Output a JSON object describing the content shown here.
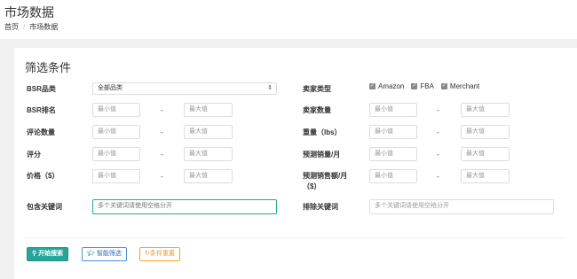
{
  "header": {
    "title": "市场数据",
    "breadcrumb_home": "首页",
    "breadcrumb_sep": "/",
    "breadcrumb_current": "市场数据"
  },
  "panel": {
    "title": "筛选条件"
  },
  "icons": {
    "search": "search-icon",
    "filter": "mortarboard-icon",
    "reset": "refresh-icon"
  },
  "filters": {
    "bsr_category": {
      "label": "BSR品类",
      "value": "全部品类"
    },
    "bsr_rank": {
      "label": "BSR排名"
    },
    "reviews": {
      "label": "评论数量"
    },
    "rating": {
      "label": "评分"
    },
    "price": {
      "label": "价格（$）"
    },
    "keywords_include": {
      "label": "包含关键词",
      "placeholder": "多个关键词请使用空格分开"
    },
    "seller_type": {
      "label": "卖家类型",
      "options": [
        "Amazon",
        "FBA",
        "Merchant"
      ]
    },
    "seller_count": {
      "label": "卖家数量"
    },
    "weight": {
      "label": "重量（lbs）"
    },
    "est_sales": {
      "label": "预测销量/月"
    },
    "est_revenue": {
      "label_line1": "预测销售额/月",
      "label_line2": "（$）"
    },
    "keywords_exclude": {
      "label": "排除关键词",
      "placeholder": "多个关键词请使用空格分开"
    },
    "min_placeholder": "最小值",
    "max_placeholder": "最大值",
    "range_sep": "-"
  },
  "buttons": {
    "search": "开始搜索",
    "smart": "智能筛选",
    "reset": "条件重置"
  },
  "colors": {
    "primary": "#26a69a",
    "blue": "#2c6fb8",
    "orange": "#f0962a"
  }
}
